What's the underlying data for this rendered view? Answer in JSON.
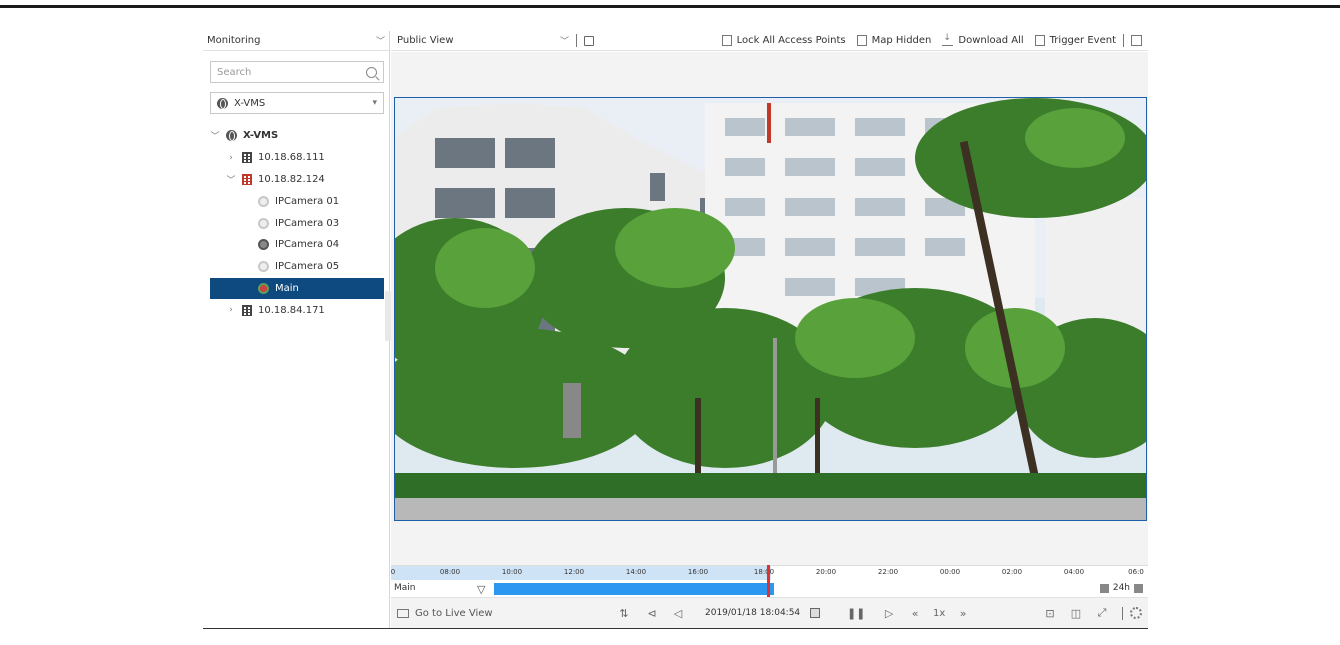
{
  "left_panel": {
    "header_label": "Monitoring",
    "search_placeholder": "Search",
    "site_selector": "X-VMS",
    "tree": [
      {
        "label": "X-VMS",
        "level": 0,
        "type": "site",
        "expanded": true
      },
      {
        "label": "10.18.68.111",
        "level": 1,
        "type": "server",
        "expanded": false
      },
      {
        "label": "10.18.82.124",
        "level": 1,
        "type": "server-alert",
        "expanded": true
      },
      {
        "label": "IPCamera 01",
        "level": 2,
        "type": "camera-offline"
      },
      {
        "label": "IPCamera 03",
        "level": 2,
        "type": "camera-offline"
      },
      {
        "label": "IPCamera 04",
        "level": 2,
        "type": "camera-online"
      },
      {
        "label": "IPCamera 05",
        "level": 2,
        "type": "camera-offline"
      },
      {
        "label": "Main",
        "level": 2,
        "type": "camera-main",
        "selected": true
      },
      {
        "label": "10.18.84.171",
        "level": 1,
        "type": "server",
        "expanded": false
      }
    ]
  },
  "toolbar": {
    "view_label": "Public View",
    "lock_label": "Lock All Access Points",
    "map_label": "Map Hidden",
    "download_label": "Download All",
    "trigger_label": "Trigger Event"
  },
  "timeline": {
    "ticks": [
      "0",
      "08:00",
      "10:00",
      "12:00",
      "14:00",
      "16:00",
      "18:00",
      "20:00",
      "22:00",
      "00:00",
      "02:00",
      "04:00",
      "06:0"
    ],
    "camera_label": "Main",
    "span_label": "24h"
  },
  "controls": {
    "live_label": "Go to Live View",
    "datetime": "2019/01/18 18:04:54",
    "speed": "1x"
  },
  "colors": {
    "selected_bg": "#0e4a80",
    "recording_bar": "#2b97f0",
    "cursor": "#e03030",
    "video_border": "#1f5ea8"
  }
}
